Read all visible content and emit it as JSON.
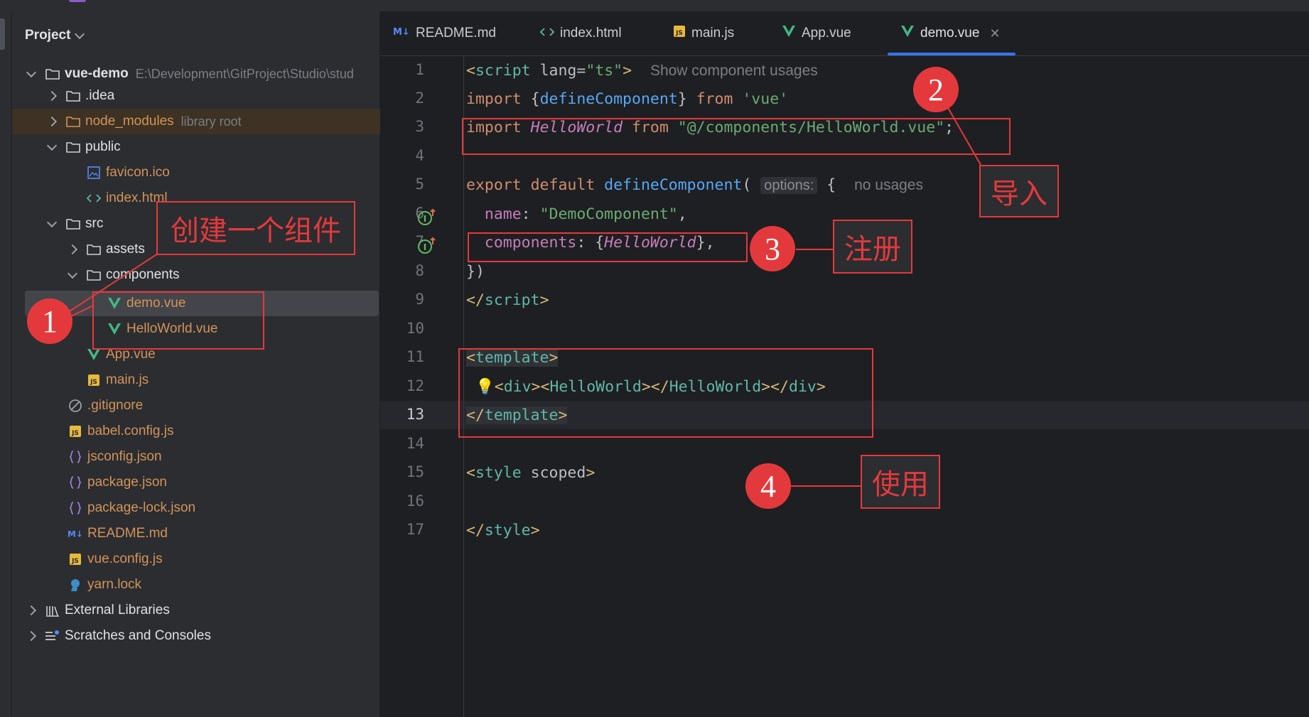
{
  "project": {
    "title": "Project",
    "tree": [
      {
        "label": "vue-demo",
        "hint": "E:\\Development\\GitProject\\Studio\\stud",
        "bold": true
      },
      {
        "label": ".idea"
      },
      {
        "label": "node_modules",
        "hint": "library root"
      },
      {
        "label": "public"
      },
      {
        "label": "favicon.ico"
      },
      {
        "label": "index.html"
      },
      {
        "label": "src"
      },
      {
        "label": "assets"
      },
      {
        "label": "components"
      },
      {
        "label": "demo.vue"
      },
      {
        "label": "HelloWorld.vue"
      },
      {
        "label": "App.vue"
      },
      {
        "label": "main.js"
      },
      {
        "label": ".gitignore"
      },
      {
        "label": "babel.config.js"
      },
      {
        "label": "jsconfig.json"
      },
      {
        "label": "package.json"
      },
      {
        "label": "package-lock.json"
      },
      {
        "label": "README.md"
      },
      {
        "label": "vue.config.js"
      },
      {
        "label": "yarn.lock"
      },
      {
        "label": "External Libraries"
      },
      {
        "label": "Scratches and Consoles"
      }
    ]
  },
  "tabs": [
    {
      "label": "README.md",
      "icon": "markdown-icon"
    },
    {
      "label": "index.html",
      "icon": "html-icon"
    },
    {
      "label": "main.js",
      "icon": "js-icon"
    },
    {
      "label": "App.vue",
      "icon": "vue-icon"
    },
    {
      "label": "demo.vue",
      "icon": "vue-icon",
      "active": true
    }
  ],
  "editor": {
    "line_numbers": [
      "1",
      "2",
      "3",
      "4",
      "5",
      "6",
      "7",
      "8",
      "9",
      "10",
      "11",
      "12",
      "13",
      "14",
      "15",
      "16",
      "17"
    ],
    "current_line": "13",
    "hints": {
      "component_usages": "Show component usages",
      "no_usages": "no usages",
      "options_inlay": "options:"
    }
  },
  "annotations": {
    "markers": [
      "1",
      "2",
      "3",
      "4"
    ],
    "labels": {
      "create": "创建一个组件",
      "import": "导入",
      "register": "注册",
      "use": "使用"
    }
  },
  "colors": {
    "annotation_red": "#e4393c",
    "vue_green": "#41b883",
    "active_tab_underline": "#3574f0"
  }
}
